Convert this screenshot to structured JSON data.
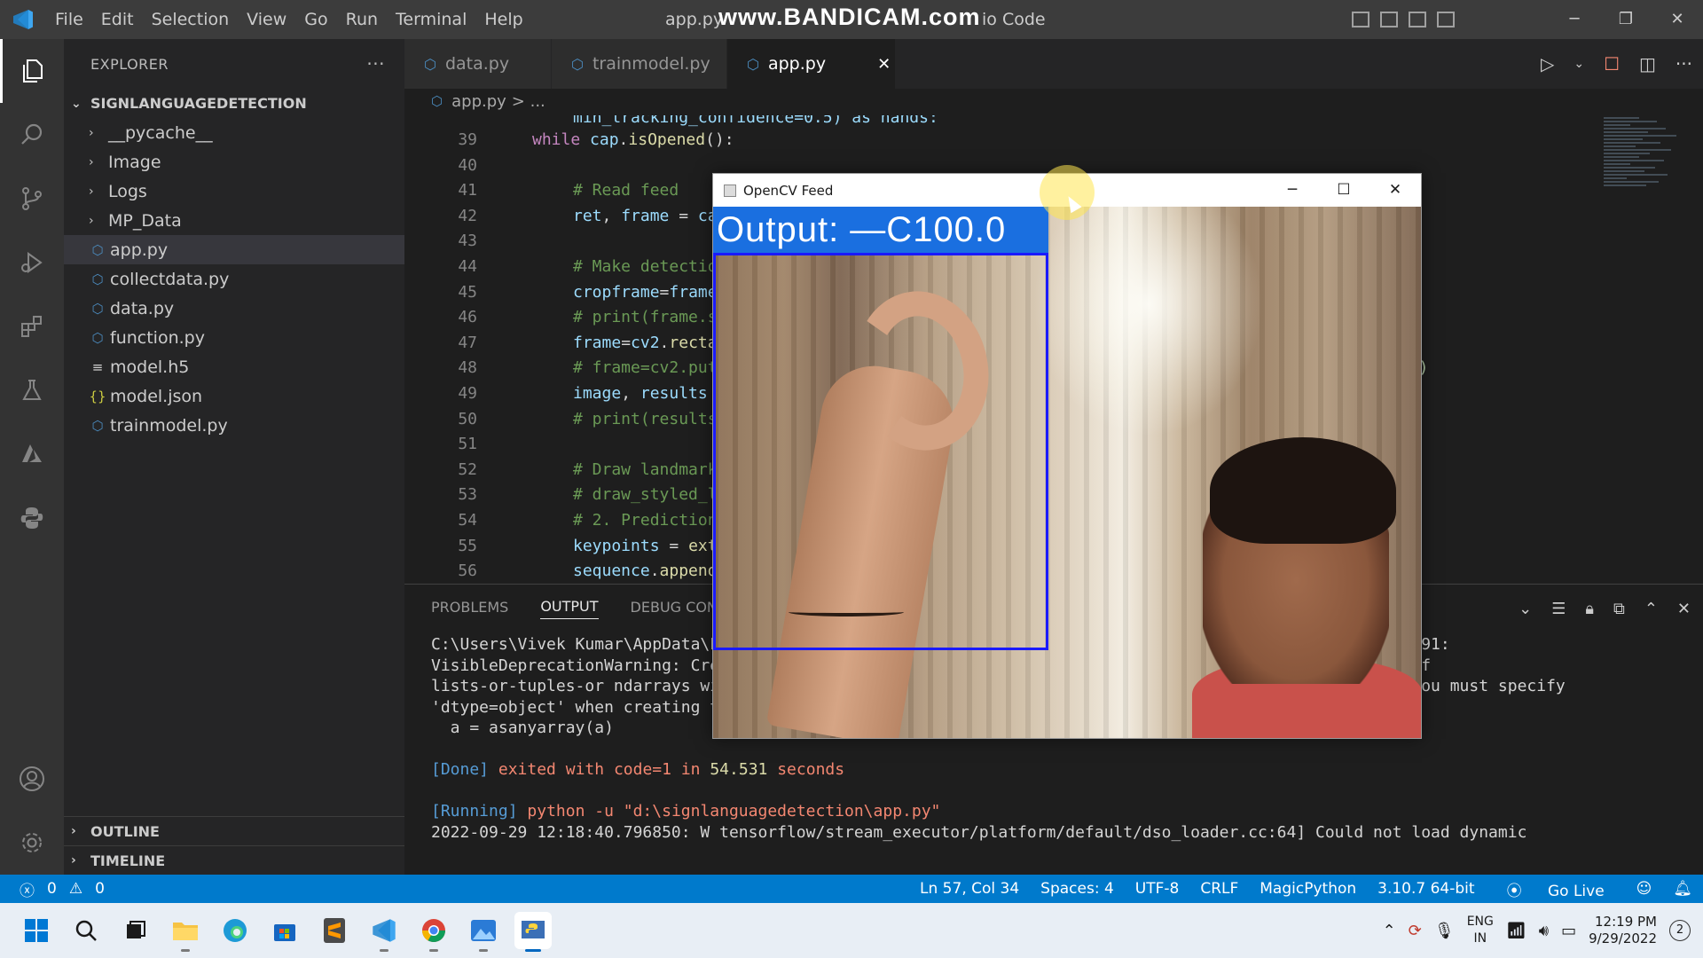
{
  "titlebar": {
    "menu": [
      "File",
      "Edit",
      "Selection",
      "View",
      "Go",
      "Run",
      "Terminal",
      "Help"
    ],
    "window_title_left": "app.py",
    "watermark": "www.BANDICAM.com",
    "window_title_right": "io Code",
    "controls": {
      "minimize": "─",
      "restore": "❐",
      "close": "✕"
    }
  },
  "activitybar": {
    "icons": [
      "explorer-icon",
      "search-icon",
      "source-control-icon",
      "run-debug-icon",
      "extensions-icon",
      "testing-icon",
      "azure-icon",
      "python-icon"
    ],
    "bottom_icons": [
      "account-icon",
      "settings-gear-icon"
    ]
  },
  "sidebar": {
    "title": "EXPLORER",
    "more": "···",
    "project": "SIGNLANGUAGEDETECTION",
    "folders": [
      "__pycache__",
      "Image",
      "Logs",
      "MP_Data"
    ],
    "files": [
      {
        "name": "app.py",
        "icon": "python-file-icon",
        "glyph": "⬡"
      },
      {
        "name": "collectdata.py",
        "icon": "python-file-icon",
        "glyph": "⬡"
      },
      {
        "name": "data.py",
        "icon": "python-file-icon",
        "glyph": "⬡"
      },
      {
        "name": "function.py",
        "icon": "python-file-icon",
        "glyph": "⬡"
      },
      {
        "name": "model.h5",
        "icon": "text-file-icon",
        "glyph": "≡"
      },
      {
        "name": "model.json",
        "icon": "json-file-icon",
        "glyph": "{}"
      },
      {
        "name": "trainmodel.py",
        "icon": "python-file-icon",
        "glyph": "⬡"
      }
    ],
    "outline": "OUTLINE",
    "timeline": "TIMELINE"
  },
  "tabs": [
    {
      "label": "data.py",
      "active": false
    },
    {
      "label": "trainmodel.py",
      "active": false
    },
    {
      "label": "app.py",
      "active": true
    }
  ],
  "tab_close": "✕",
  "breadcrumb": {
    "file": "app.py",
    "rest": "> ..."
  },
  "code": {
    "top_partial": "min_tracking_confidence=0.5) as hands:",
    "lines": [
      {
        "n": "39",
        "html": "<span class='kw'>while</span> <span class='var'>cap</span>.<span class='fn'>isOpened</span>():",
        "indent": 1
      },
      {
        "n": "40",
        "html": "",
        "indent": 2
      },
      {
        "n": "41",
        "html": "<span class='cm'># Read feed</span>",
        "indent": 2
      },
      {
        "n": "42",
        "html": "<span class='var'>ret</span>, <span class='var'>frame</span> = <span class='var'>cap</span>.<span class='fn'>read</span>()",
        "indent": 2
      },
      {
        "n": "43",
        "html": "",
        "indent": 2
      },
      {
        "n": "44",
        "html": "<span class='cm'># Make detections</span>",
        "indent": 2
      },
      {
        "n": "45",
        "html": "<span class='var'>cropframe</span>=<span class='var'>frame</span>[40:400,0:300]",
        "indent": 2
      },
      {
        "n": "46",
        "html": "<span class='cm'># print(frame.shape)</span>",
        "indent": 2
      },
      {
        "n": "47",
        "html": "<span class='var'>frame</span>=<span class='var'>cv2</span>.<span class='fn'>rectangle</span>(<span class='var'>frame</span>,(0,40),(300,400),255,2)",
        "indent": 2
      },
      {
        "n": "48",
        "html": "<span class='cm'># frame=cv2.putText(frame,\"Active Region\",(75,25),cv2.FONT_HERSHEY_COMPLEX_SMALL,2,</span><span class='num'>255,2)</span>",
        "indent": 2
      },
      {
        "n": "49",
        "html": "<span class='var'>image</span>, <span class='var'>results</span> = <span class='fn'>mediapipe_detection</span>(<span class='var'>cropframe</span>, <span class='var'>hands</span>)",
        "indent": 2
      },
      {
        "n": "50",
        "html": "<span class='cm'># print(results)</span>",
        "indent": 2
      },
      {
        "n": "51",
        "html": "",
        "indent": 2
      },
      {
        "n": "52",
        "html": "<span class='cm'># Draw landmarks</span>",
        "indent": 2
      },
      {
        "n": "53",
        "html": "<span class='cm'># draw_styled_landmarks(image, results)</span>",
        "indent": 2
      },
      {
        "n": "54",
        "html": "<span class='cm'># 2. Prediction logic</span>",
        "indent": 2
      },
      {
        "n": "55",
        "html": "<span class='var'>keypoints</span> = <span class='fn'>extract_keypoints</span>(<span class='var'>results</span>)",
        "indent": 2
      },
      {
        "n": "56",
        "html": "<span class='var'>sequence</span>.<span class='fn'>append</span>(<span class='var'>keypoints</span>)",
        "indent": 2
      }
    ]
  },
  "panel": {
    "tabs": [
      "PROBLEMS",
      "OUTPUT",
      "DEBUG CONSOLE"
    ],
    "active_tab": "OUTPUT",
    "output_lines": [
      {
        "html": "<span class='c-white'>C:\\Users\\Vivek Kumar\\AppData\\Local\\Programs\\Python\\Python310\\lib\\site-packages\\numpy\\core\\_asarray.py:591:</span>"
      },
      {
        "html": "<span class='c-white'>VisibleDeprecationWarning: Creating an ndarray from ragged nested sequences (which is a list-or-tuple of</span>"
      },
      {
        "html": "<span class='c-white'>lists-or-tuples-or ndarrays with different lengths or shapes) is deprecated. If you meant to do this, you must specify</span>"
      },
      {
        "html": "<span class='c-white'>'dtype=object' when creating the ndarray.</span>"
      },
      {
        "html": "<span class='c-white'>  a = asanyarray(a)</span>"
      },
      {
        "html": ""
      },
      {
        "html": "<span class='c-blue'>[Done]</span> <span class='c-red'>exited with</span> <span class='c-red'>code=1</span> <span class='c-red'>in</span> <span class='c-yellow'>54.531</span> <span class='c-red'>seconds</span>"
      },
      {
        "html": ""
      },
      {
        "html": "<span class='c-blue'>[Running]</span> <span class='c-red'>python -u \"d:\\signlanguagedetection\\app.py\"</span>"
      },
      {
        "html": "<span class='c-white'>2022-09-29 12:18:40.796850: W tensorflow/stream_executor/platform/default/dso_loader.cc:64] Could not load dynamic</span>"
      }
    ]
  },
  "cv_window": {
    "title": "OpenCV Feed",
    "controls": {
      "minimize": "─",
      "maximize": "☐",
      "close": "✕"
    },
    "output_text": "Output: —C100.0"
  },
  "statusbar": {
    "errors": "0",
    "warnings": "0",
    "position": "Ln 57, Col 34",
    "spaces": "Spaces: 4",
    "encoding": "UTF-8",
    "eol": "CRLF",
    "language": "MagicPython",
    "interpreter": "3.10.7 64-bit",
    "golive": "Go Live"
  },
  "taskbar": {
    "apps": [
      "start-icon",
      "search-icon",
      "task-view-icon",
      "file-explorer-icon",
      "edge-icon",
      "store-icon",
      "sublime-icon",
      "vscode-icon",
      "chrome-icon",
      "photos-icon",
      "python-window-icon"
    ],
    "lang_top": "ENG",
    "lang_bottom": "IN",
    "time": "12:19 PM",
    "date": "9/29/2022",
    "notifications": "2"
  },
  "colors": {
    "accent": "#007acc",
    "roi_box": "#1a1aff",
    "banner": "#1a6fe0"
  }
}
